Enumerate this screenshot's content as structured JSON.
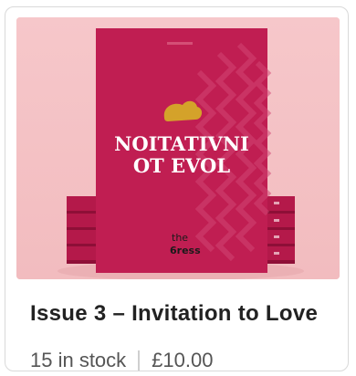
{
  "product": {
    "title": "Issue 3 – Invitation to Love",
    "stock": "15 in stock",
    "price": "£10.00",
    "cover_title_line1": "NOITATIVNI",
    "cover_title_line2": "OT EVOL",
    "cover_logo_top": "the",
    "cover_logo_bottom": "6ress"
  },
  "colors": {
    "background": "#f4c1c4",
    "cover": "#c01e52",
    "cover_dark": "#a81545",
    "accent_gold": "#d4a22a"
  }
}
